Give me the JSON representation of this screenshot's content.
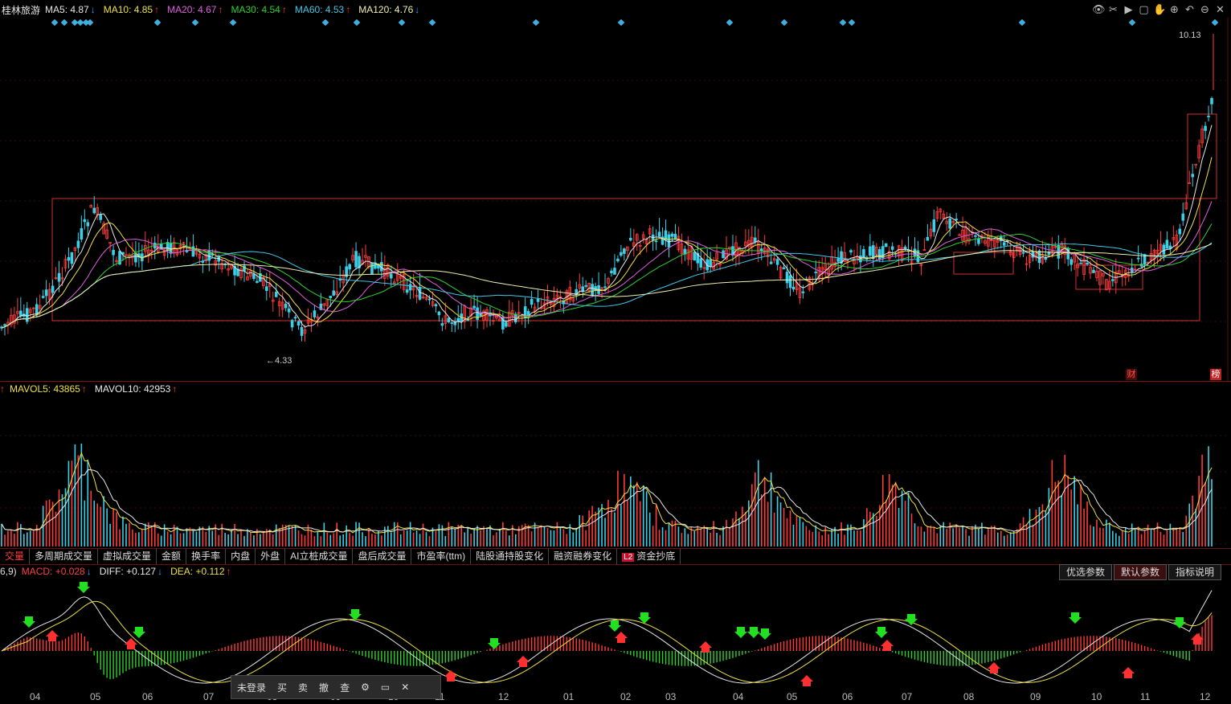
{
  "header": {
    "stock_name": "桂林旅游",
    "ma": [
      {
        "label": "MA5: 4.87",
        "trend": "down",
        "color": "#e8e8e8"
      },
      {
        "label": "MA10: 4.85",
        "trend": "up",
        "color": "#f0e040"
      },
      {
        "label": "MA20: 4.67",
        "trend": "up",
        "color": "#e060e0"
      },
      {
        "label": "MA30: 4.54",
        "trend": "up",
        "color": "#30d030"
      },
      {
        "label": "MA60: 4.53",
        "trend": "up",
        "color": "#40c8e8"
      },
      {
        "label": "MA120: 4.76",
        "trend": "down",
        "color": "#f0f0b0"
      }
    ],
    "arrows": {
      "up": "↑",
      "down": "↓"
    }
  },
  "price_chart": {
    "high_label": "10.13",
    "low_label": "←4.33",
    "finance_badge": "财",
    "rank_badge": "榜"
  },
  "volume_panel": {
    "items": [
      {
        "label": "MAVOL5: 43865",
        "color": "#f0e040"
      },
      {
        "label": "MAVOL10: 42953",
        "color": "#e8e8e8"
      }
    ]
  },
  "tabs": {
    "items": [
      "交量",
      "多周期成交量",
      "虚拟成交量",
      "金额",
      "换手率",
      "内盘",
      "外盘",
      "AI立桩成交量",
      "盘后成交量",
      "市盈率(ttm)",
      "陆股通持股变化",
      "融资融券变化",
      "资金抄底"
    ],
    "l2_badge": "L2"
  },
  "macd_panel": {
    "prefix": "6,9)",
    "items": [
      {
        "label": "MACD: +0.028",
        "trend": "down",
        "color": "#ff4040"
      },
      {
        "label": "DIFF: +0.127",
        "trend": "down",
        "color": "#e8e8e8"
      },
      {
        "label": "DEA: +0.112",
        "trend": "up",
        "color": "#f0e040"
      }
    ],
    "buttons": [
      "优选参数",
      "默认参数",
      "指标说明"
    ]
  },
  "x_axis": [
    "04",
    "05",
    "06",
    "07",
    "08",
    "09",
    "10",
    "11",
    "12",
    "01",
    "02",
    "03",
    "04",
    "05",
    "06",
    "07",
    "08",
    "09",
    "10",
    "11",
    "12"
  ],
  "trade_bar": {
    "login": "未登录",
    "buy": "买",
    "sell": "卖",
    "cancel": "撤",
    "query": "查"
  },
  "colors": {
    "up": "#ff3b3b",
    "down": "#3ad0e8",
    "box": "#d03030"
  }
}
